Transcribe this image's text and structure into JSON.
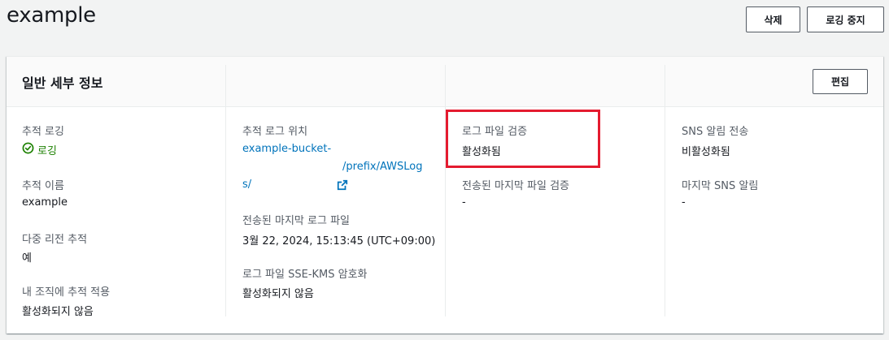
{
  "header": {
    "title": "example",
    "delete_label": "삭제",
    "stop_logging_label": "로깅 중지"
  },
  "general": {
    "title": "일반 세부 정보",
    "edit_label": "편집",
    "trail_logging": {
      "label": "추적 로깅",
      "value": "로깅",
      "status_color": "#1d8102"
    },
    "trail_name": {
      "label": "추적 이름",
      "value": "example"
    },
    "multi_region": {
      "label": "다중 리전 추적",
      "value": "예"
    },
    "org_trail": {
      "label": "내 조직에 추적 적용",
      "value": "활성화되지 않음"
    },
    "log_location": {
      "label": "추적 로그 위치",
      "line1": "example-bucket-",
      "line2": "/prefix/AWSLog",
      "line3": "s/"
    },
    "last_log_file": {
      "label": "전송된 마지막 로그 파일",
      "value": "3월 22, 2024, 15:13:45 (UTC+09:00)"
    },
    "sse_kms": {
      "label": "로그 파일 SSE-KMS 암호화",
      "value": "활성화되지 않음"
    },
    "log_validation": {
      "label": "로그 파일 검증",
      "value": "활성화됨"
    },
    "last_digest": {
      "label": "전송된 마지막 파일 검증",
      "value": "-"
    },
    "sns_delivery": {
      "label": "SNS 알림 전송",
      "value": "비활성화됨"
    },
    "last_sns": {
      "label": "마지막 SNS 알림",
      "value": "-"
    }
  },
  "colors": {
    "link": "#0073bb",
    "highlight": "#e41b2f"
  }
}
